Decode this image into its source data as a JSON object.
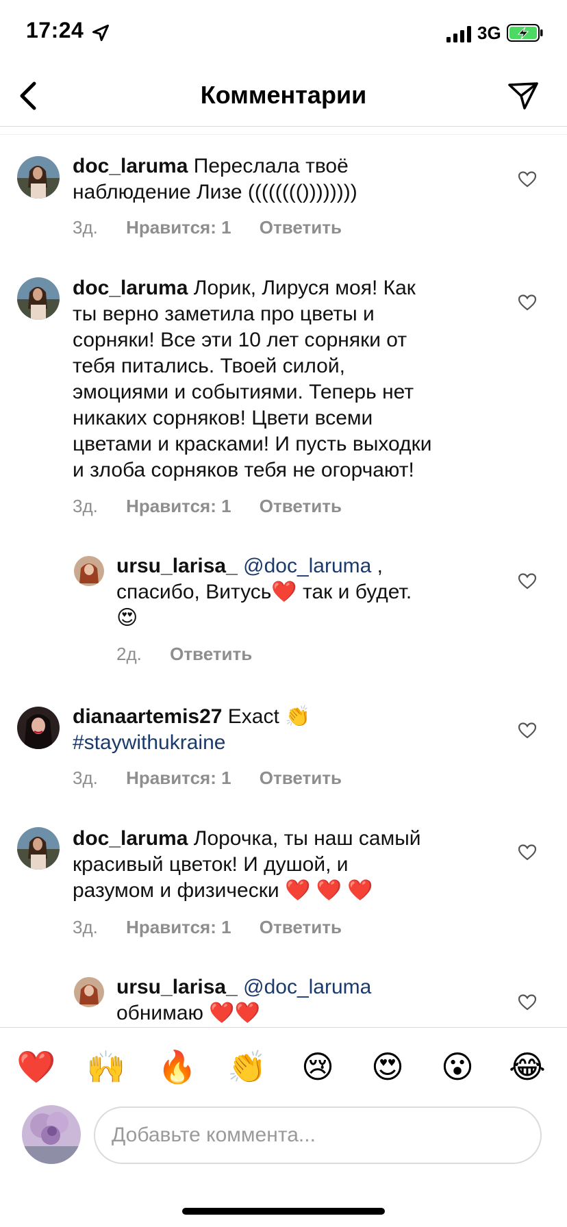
{
  "status_bar": {
    "time": "17:24",
    "network": "3G",
    "icons": [
      "location-arrow-icon",
      "signal-icon",
      "battery-charging-icon"
    ]
  },
  "header": {
    "title": "Комментарии",
    "back_icon": "chevron-left-icon",
    "share_icon": "send-icon"
  },
  "comments": [
    {
      "user": "doc_laruma",
      "text_lines": [
        "Переслала твоё",
        "наблюдение Лизе (((((((())))))))"
      ],
      "time": "3д.",
      "likes": "Нравится: 1",
      "reply": "Ответить"
    },
    {
      "user": "doc_laruma",
      "text_lines": [
        "Лорик, Лируся моя! Как",
        "ты верно заметила про цветы и",
        "сорняки! Все эти 10 лет сорняки от",
        "тебя питались. Твоей силой,",
        "эмоциями и событиями. Теперь нет",
        "никаких сорняков! Цвети всеми",
        "цветами и красками! И пусть выходки",
        "и злоба сорняков  тебя не огорчают!"
      ],
      "time": "3д.",
      "likes": "Нравится: 1",
      "reply": "Ответить"
    },
    {
      "user": "ursu_larisa_",
      "mention": "@doc_laruma",
      "text_after_mention": " ,",
      "line2": "спасибо, Витусь❤️ так и будет.",
      "line3": "😍",
      "time": "2д.",
      "reply": "Ответить"
    },
    {
      "user": "dianaartemis27",
      "text": "Exact 👏",
      "hashtag": "#staywithukraine",
      "time": "3д.",
      "likes": "Нравится: 1",
      "reply": "Ответить"
    },
    {
      "user": "doc_laruma",
      "text_lines": [
        "Лорочка, ты наш самый",
        "красивый цветок! И душой, и",
        "разумом и физически ❤️ ❤️ ❤️"
      ],
      "time": "3д.",
      "likes": "Нравится: 1",
      "reply": "Ответить"
    },
    {
      "user": "ursu_larisa_",
      "mention": "@doc_laruma",
      "line2": "обнимаю ❤️❤️"
    }
  ],
  "emoji_bar": [
    "❤️",
    "🙌",
    "🔥",
    "👏",
    "😢",
    "😍",
    "😮",
    "😂"
  ],
  "input": {
    "placeholder": "Добавьте коммента..."
  },
  "colors": {
    "accent_link": "#1a3a6e",
    "meta_gray": "#8e8e8e",
    "divider": "#dbdbdb",
    "battery_green": "#4cd964"
  }
}
